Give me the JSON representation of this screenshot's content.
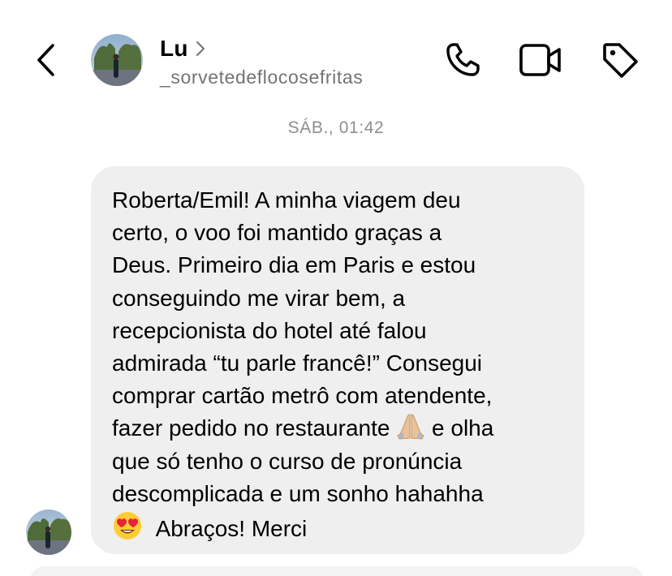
{
  "header": {
    "name": "Lu",
    "username": "_sorvetedeflocosefritas",
    "icons": {
      "back": "chevron-left-icon",
      "name_arrow": "chevron-right-icon",
      "call": "phone-icon",
      "video": "video-camera-icon",
      "tag": "tag-icon"
    }
  },
  "timestamp": "SÁB., 01:42",
  "message": {
    "lines": [
      "Roberta/Emil! A minha viagem deu",
      "certo, o voo foi mantido graças a",
      "Deus. Primeiro dia em Paris e estou",
      "conseguindo me virar bem, a",
      "recepcionista do hotel até falou",
      "admirada “tu parle francê!” Consegui",
      "comprar cartão metrô com atendente,",
      "fazer pedido no restaurante",
      "e olha",
      "que só tenho o curso de pronúncia",
      "descomplicada  e um sonho hahahha",
      "Abraços! Merci"
    ],
    "emojis": [
      "praying-hands-emoji",
      "heart-eyes-emoji"
    ]
  },
  "colors": {
    "bubble": "#efefef",
    "secondary_text": "#737373",
    "timestamp": "#8e8e8e"
  }
}
